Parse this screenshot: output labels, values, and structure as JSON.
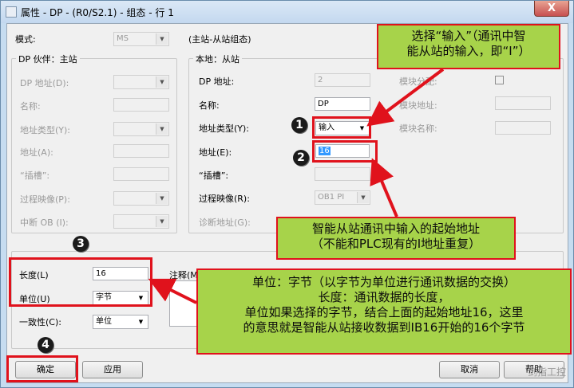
{
  "window": {
    "title": "属性 - DP - (R0/S2.1) - 组态 - 行 1",
    "close_label": "X"
  },
  "mode": {
    "label": "模式:",
    "value": "MS",
    "note": "(主站-从站组态)"
  },
  "partner": {
    "group_title": "DP 伙伴：主站",
    "dp_address": "DP 地址(D):",
    "name": "名称:",
    "address_type": "地址类型(Y):",
    "address": "地址(A):",
    "slot": "“插槽”:",
    "process_image": "过程映像(P):",
    "interrupt_ob": "中断 OB (I):"
  },
  "local": {
    "group_title": "本地：从站",
    "dp_address_label": "DP 地址:",
    "dp_address_value": "2",
    "name_label": "名称:",
    "name_value": "DP",
    "address_type_label": "地址类型(Y):",
    "address_type_value": "输入",
    "address_label": "地址(E):",
    "address_value": "16",
    "slot_label": "“插槽”:",
    "process_image_label": "过程映像(R):",
    "process_image_value": "OB1 PI",
    "diag_address_label": "诊断地址(G):",
    "module_assign_label": "模块分配:",
    "module_address_label": "模块地址:",
    "module_name_label": "模块名称:"
  },
  "bottom": {
    "length_label": "长度(L)",
    "length_value": "16",
    "unit_label": "单位(U)",
    "unit_value": "字节",
    "consistency_label": "一致性(C):",
    "consistency_value": "单位",
    "comment_label": "注释(M"
  },
  "buttons": {
    "ok": "确定",
    "apply": "应用",
    "cancel": "取消",
    "help": "帮助"
  },
  "annotations": {
    "step1": "1",
    "step2": "2",
    "step3": "3",
    "step4": "4",
    "callout_input_line1": "选择“输入”（通讯中智",
    "callout_input_line2": "能从站的输入，即“I”）",
    "callout_address_line1": "智能从站通讯中输入的起始地址",
    "callout_address_line2": "（不能和PLC现有的I地址重复）",
    "callout_unit_line1": "单位：字节（以字节为单位进行通讯数据的交换）",
    "callout_unit_line2": "长度：通讯数据的长度，",
    "callout_unit_line3": "单位如果选择的字节，结合上面的起始地址16，这里",
    "callout_unit_line4": "的意思就是智能从站接收数据到IB16开始的16个字节",
    "watermark": "剑指工控"
  },
  "colors": {
    "callout_fill": "#a7d34a",
    "highlight_red": "#e0121c"
  }
}
